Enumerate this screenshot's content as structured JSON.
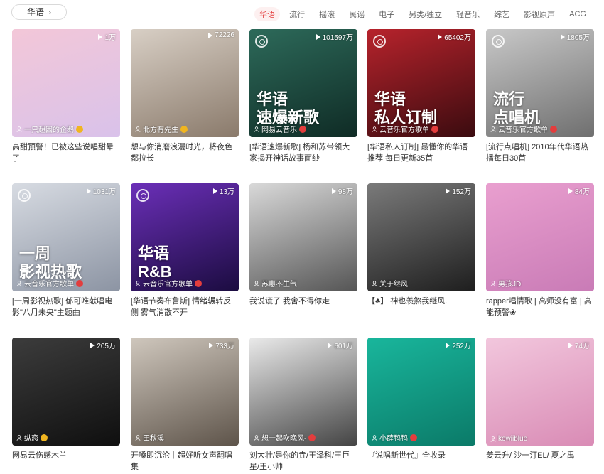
{
  "category_button": {
    "label": "华语",
    "icon": "chevron-right-icon"
  },
  "tabs": [
    {
      "label": "华语",
      "active": true
    },
    {
      "label": "流行",
      "active": false
    },
    {
      "label": "摇滚",
      "active": false
    },
    {
      "label": "民谣",
      "active": false
    },
    {
      "label": "电子",
      "active": false
    },
    {
      "label": "另类/独立",
      "active": false
    },
    {
      "label": "轻音乐",
      "active": false
    },
    {
      "label": "综艺",
      "active": false
    },
    {
      "label": "影视原声",
      "active": false
    },
    {
      "label": "ACG",
      "active": false
    }
  ],
  "playlists": [
    {
      "play_count": "1万",
      "creator": "一只超困的企鹅",
      "badge": "vip",
      "title": "高甜预警！已被这些说唱甜晕了",
      "overlay": "",
      "logo": false,
      "colors": [
        "#f3c7d8",
        "#d9c2ea"
      ]
    },
    {
      "play_count": "72226",
      "creator": "北方有先生",
      "badge": "vip",
      "title": "想与你消磨浪漫时光，将夜色都拉长",
      "overlay": "",
      "logo": false,
      "colors": [
        "#d8cfc5",
        "#8a7a6b"
      ]
    },
    {
      "play_count": "101597万",
      "creator": "网易云音乐",
      "badge": "v",
      "title": "[华语速爆新歌] 杨和苏带领大家揭开神话故事面纱",
      "overlay": "华语\n速爆新歌",
      "logo": true,
      "colors": [
        "#2d6a5a",
        "#0f2b25"
      ]
    },
    {
      "play_count": "65402万",
      "creator": "云音乐官方歌单",
      "badge": "v",
      "title": "[华语私人订制] 最懂你的华语推荐 每日更新35首",
      "overlay": "华语\n私人订制",
      "logo": true,
      "colors": [
        "#b7232c",
        "#3a0b0f"
      ]
    },
    {
      "play_count": "1805万",
      "creator": "云音乐官方歌单",
      "badge": "v",
      "title": "[流行点唱机] 2010年代华语热播每日30首",
      "overlay": "流行\n点唱机",
      "logo": true,
      "colors": [
        "#c8c8c8",
        "#6f6f6f"
      ]
    },
    {
      "play_count": "1031万",
      "creator": "云音乐官方歌单",
      "badge": "v",
      "title": "[一周影视热歌] 郁可唯献唱电影\"八月未央\"主题曲",
      "overlay": "一周\n影视热歌",
      "logo": true,
      "colors": [
        "#d7dbe2",
        "#8c94a3"
      ]
    },
    {
      "play_count": "13万",
      "creator": "云音乐官方歌单",
      "badge": "v",
      "title": "[华语节奏布鲁斯] 情绪辗转反侧 雾气消散不开",
      "overlay": "华语\nR&B",
      "logo": true,
      "colors": [
        "#6b2fb8",
        "#1b0c40"
      ]
    },
    {
      "play_count": "98万",
      "creator": "苏惠不生气",
      "badge": "",
      "title": "我说谎了 我舍不得你走",
      "overlay": "",
      "logo": false,
      "colors": [
        "#d9d9d9",
        "#555555"
      ]
    },
    {
      "play_count": "152万",
      "creator": "关于继风",
      "badge": "",
      "title": "【♣】 神也羡煞我继风.",
      "overlay": "",
      "logo": false,
      "colors": [
        "#7a7a7a",
        "#1e1e1e"
      ]
    },
    {
      "play_count": "84万",
      "creator": "男孩JD",
      "badge": "",
      "title": "rapper唱情歌 | 高师没有富 | 高能预警❀",
      "overlay": "",
      "logo": false,
      "colors": [
        "#e99fcf",
        "#c97bb6"
      ]
    },
    {
      "play_count": "205万",
      "creator": "纵恋",
      "badge": "vip",
      "title": "网易云伤感木兰",
      "overlay": "",
      "logo": false,
      "colors": [
        "#3c3c3c",
        "#0f0f0f"
      ]
    },
    {
      "play_count": "733万",
      "creator": "田秋溪",
      "badge": "",
      "title": "开嗓即沉沦｜超好听女声翻唱集",
      "overlay": "",
      "logo": false,
      "colors": [
        "#cfc7bd",
        "#5e544a"
      ]
    },
    {
      "play_count": "601万",
      "creator": "想一起吹晚风-",
      "badge": "v",
      "title": "刘大壮/是你的垚/王泽科/王巨星/王小帅",
      "overlay": "",
      "logo": false,
      "colors": [
        "#eaeaea",
        "#444444"
      ]
    },
    {
      "play_count": "252万",
      "creator": "小薛鸭鸭",
      "badge": "v",
      "title": "『说唱新世代』全收录",
      "overlay": "",
      "logo": false,
      "colors": [
        "#19b69c",
        "#0b7a68"
      ]
    },
    {
      "play_count": "74万",
      "creator": "kowiiblue",
      "badge": "",
      "title": "姜云升/ 沙一汀EL/ 夏之禹",
      "overlay": "",
      "logo": false,
      "colors": [
        "#f2c7dd",
        "#d98bb5"
      ]
    }
  ]
}
